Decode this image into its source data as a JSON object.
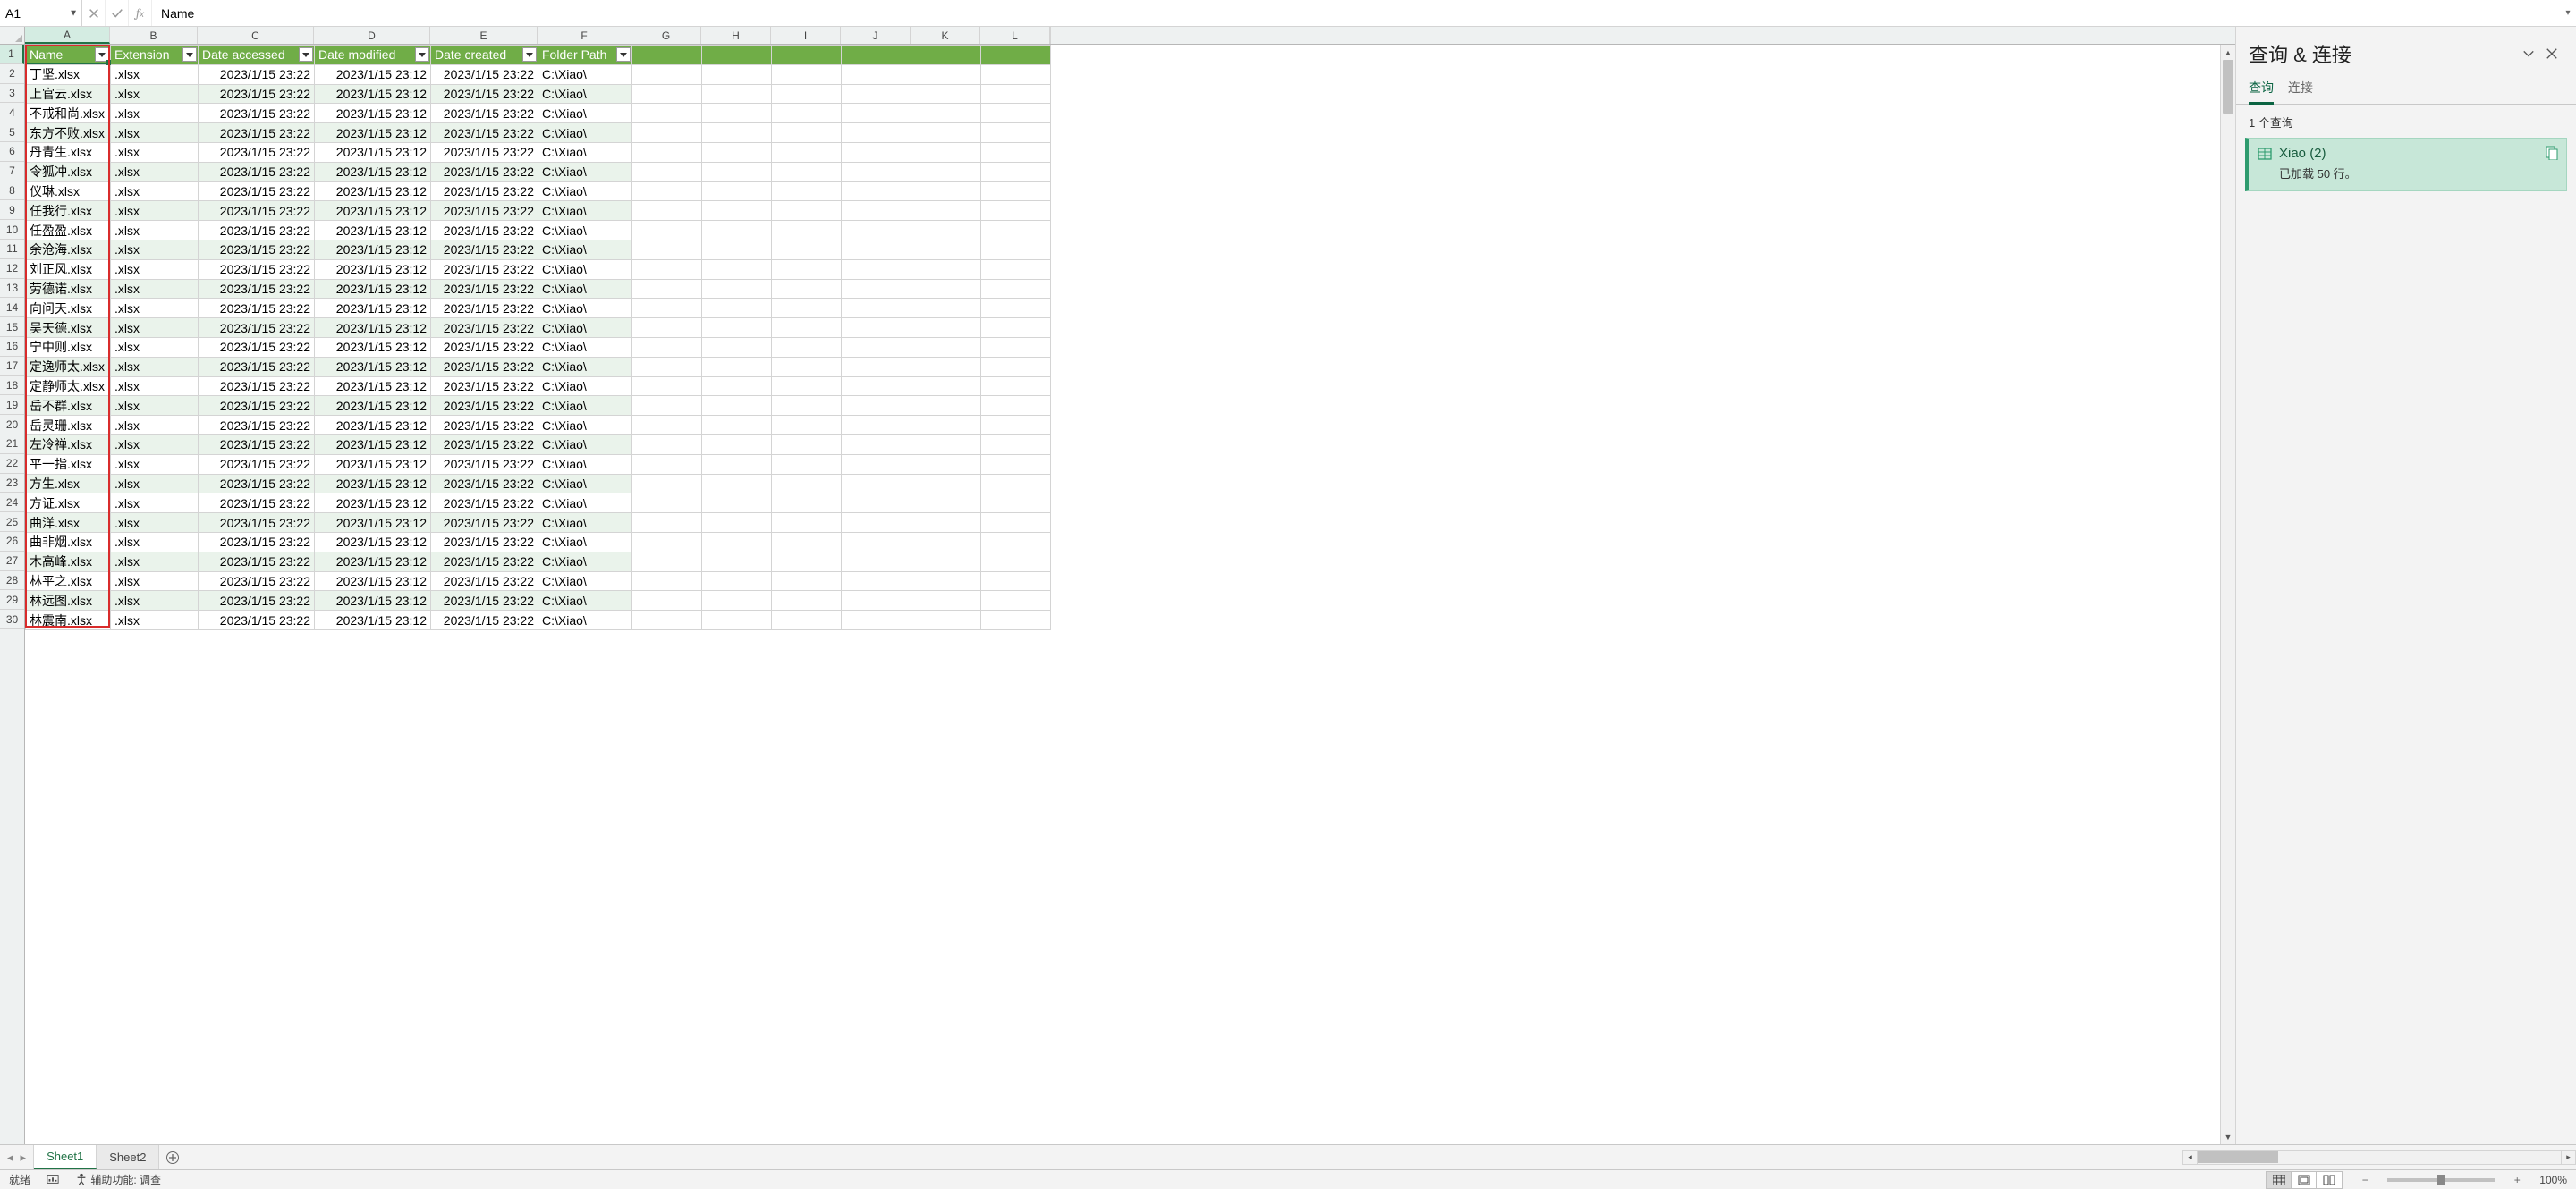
{
  "formula_bar": {
    "name_box": "A1",
    "formula": "Name"
  },
  "columns": [
    "A",
    "B",
    "C",
    "D",
    "E",
    "F",
    "G",
    "H",
    "I",
    "J",
    "K",
    "L"
  ],
  "col_widths_class": [
    "wA",
    "wB",
    "wC",
    "wD",
    "wE",
    "wF",
    "wRest",
    "wRest",
    "wRest",
    "wRest",
    "wRest",
    "wRest"
  ],
  "row_count_visible": 30,
  "table": {
    "headers": [
      "Name",
      "Extension",
      "Date accessed",
      "Date modified",
      "Date created",
      "Folder Path"
    ],
    "rows": [
      {
        "name": "丁坚.xlsx",
        "ext": ".xlsx",
        "accessed": "2023/1/15 23:22",
        "modified": "2023/1/15 23:12",
        "created": "2023/1/15 23:22",
        "folder": "C:\\Xiao\\"
      },
      {
        "name": "上官云.xlsx",
        "ext": ".xlsx",
        "accessed": "2023/1/15 23:22",
        "modified": "2023/1/15 23:12",
        "created": "2023/1/15 23:22",
        "folder": "C:\\Xiao\\"
      },
      {
        "name": "不戒和尚.xlsx",
        "ext": ".xlsx",
        "accessed": "2023/1/15 23:22",
        "modified": "2023/1/15 23:12",
        "created": "2023/1/15 23:22",
        "folder": "C:\\Xiao\\"
      },
      {
        "name": "东方不败.xlsx",
        "ext": ".xlsx",
        "accessed": "2023/1/15 23:22",
        "modified": "2023/1/15 23:12",
        "created": "2023/1/15 23:22",
        "folder": "C:\\Xiao\\"
      },
      {
        "name": "丹青生.xlsx",
        "ext": ".xlsx",
        "accessed": "2023/1/15 23:22",
        "modified": "2023/1/15 23:12",
        "created": "2023/1/15 23:22",
        "folder": "C:\\Xiao\\"
      },
      {
        "name": "令狐冲.xlsx",
        "ext": ".xlsx",
        "accessed": "2023/1/15 23:22",
        "modified": "2023/1/15 23:12",
        "created": "2023/1/15 23:22",
        "folder": "C:\\Xiao\\"
      },
      {
        "name": "仪琳.xlsx",
        "ext": ".xlsx",
        "accessed": "2023/1/15 23:22",
        "modified": "2023/1/15 23:12",
        "created": "2023/1/15 23:22",
        "folder": "C:\\Xiao\\"
      },
      {
        "name": "任我行.xlsx",
        "ext": ".xlsx",
        "accessed": "2023/1/15 23:22",
        "modified": "2023/1/15 23:12",
        "created": "2023/1/15 23:22",
        "folder": "C:\\Xiao\\"
      },
      {
        "name": "任盈盈.xlsx",
        "ext": ".xlsx",
        "accessed": "2023/1/15 23:22",
        "modified": "2023/1/15 23:12",
        "created": "2023/1/15 23:22",
        "folder": "C:\\Xiao\\"
      },
      {
        "name": "余沧海.xlsx",
        "ext": ".xlsx",
        "accessed": "2023/1/15 23:22",
        "modified": "2023/1/15 23:12",
        "created": "2023/1/15 23:22",
        "folder": "C:\\Xiao\\"
      },
      {
        "name": "刘正风.xlsx",
        "ext": ".xlsx",
        "accessed": "2023/1/15 23:22",
        "modified": "2023/1/15 23:12",
        "created": "2023/1/15 23:22",
        "folder": "C:\\Xiao\\"
      },
      {
        "name": "劳德诺.xlsx",
        "ext": ".xlsx",
        "accessed": "2023/1/15 23:22",
        "modified": "2023/1/15 23:12",
        "created": "2023/1/15 23:22",
        "folder": "C:\\Xiao\\"
      },
      {
        "name": "向问天.xlsx",
        "ext": ".xlsx",
        "accessed": "2023/1/15 23:22",
        "modified": "2023/1/15 23:12",
        "created": "2023/1/15 23:22",
        "folder": "C:\\Xiao\\"
      },
      {
        "name": "吴天德.xlsx",
        "ext": ".xlsx",
        "accessed": "2023/1/15 23:22",
        "modified": "2023/1/15 23:12",
        "created": "2023/1/15 23:22",
        "folder": "C:\\Xiao\\"
      },
      {
        "name": "宁中则.xlsx",
        "ext": ".xlsx",
        "accessed": "2023/1/15 23:22",
        "modified": "2023/1/15 23:12",
        "created": "2023/1/15 23:22",
        "folder": "C:\\Xiao\\"
      },
      {
        "name": "定逸师太.xlsx",
        "ext": ".xlsx",
        "accessed": "2023/1/15 23:22",
        "modified": "2023/1/15 23:12",
        "created": "2023/1/15 23:22",
        "folder": "C:\\Xiao\\"
      },
      {
        "name": "定静师太.xlsx",
        "ext": ".xlsx",
        "accessed": "2023/1/15 23:22",
        "modified": "2023/1/15 23:12",
        "created": "2023/1/15 23:22",
        "folder": "C:\\Xiao\\"
      },
      {
        "name": "岳不群.xlsx",
        "ext": ".xlsx",
        "accessed": "2023/1/15 23:22",
        "modified": "2023/1/15 23:12",
        "created": "2023/1/15 23:22",
        "folder": "C:\\Xiao\\"
      },
      {
        "name": "岳灵珊.xlsx",
        "ext": ".xlsx",
        "accessed": "2023/1/15 23:22",
        "modified": "2023/1/15 23:12",
        "created": "2023/1/15 23:22",
        "folder": "C:\\Xiao\\"
      },
      {
        "name": "左冷禅.xlsx",
        "ext": ".xlsx",
        "accessed": "2023/1/15 23:22",
        "modified": "2023/1/15 23:12",
        "created": "2023/1/15 23:22",
        "folder": "C:\\Xiao\\"
      },
      {
        "name": "平一指.xlsx",
        "ext": ".xlsx",
        "accessed": "2023/1/15 23:22",
        "modified": "2023/1/15 23:12",
        "created": "2023/1/15 23:22",
        "folder": "C:\\Xiao\\"
      },
      {
        "name": "方生.xlsx",
        "ext": ".xlsx",
        "accessed": "2023/1/15 23:22",
        "modified": "2023/1/15 23:12",
        "created": "2023/1/15 23:22",
        "folder": "C:\\Xiao\\"
      },
      {
        "name": "方证.xlsx",
        "ext": ".xlsx",
        "accessed": "2023/1/15 23:22",
        "modified": "2023/1/15 23:12",
        "created": "2023/1/15 23:22",
        "folder": "C:\\Xiao\\"
      },
      {
        "name": "曲洋.xlsx",
        "ext": ".xlsx",
        "accessed": "2023/1/15 23:22",
        "modified": "2023/1/15 23:12",
        "created": "2023/1/15 23:22",
        "folder": "C:\\Xiao\\"
      },
      {
        "name": "曲非烟.xlsx",
        "ext": ".xlsx",
        "accessed": "2023/1/15 23:22",
        "modified": "2023/1/15 23:12",
        "created": "2023/1/15 23:22",
        "folder": "C:\\Xiao\\"
      },
      {
        "name": "木高峰.xlsx",
        "ext": ".xlsx",
        "accessed": "2023/1/15 23:22",
        "modified": "2023/1/15 23:12",
        "created": "2023/1/15 23:22",
        "folder": "C:\\Xiao\\"
      },
      {
        "name": "林平之.xlsx",
        "ext": ".xlsx",
        "accessed": "2023/1/15 23:22",
        "modified": "2023/1/15 23:12",
        "created": "2023/1/15 23:22",
        "folder": "C:\\Xiao\\"
      },
      {
        "name": "林远图.xlsx",
        "ext": ".xlsx",
        "accessed": "2023/1/15 23:22",
        "modified": "2023/1/15 23:12",
        "created": "2023/1/15 23:22",
        "folder": "C:\\Xiao\\"
      },
      {
        "name": "林震南.xlsx",
        "ext": ".xlsx",
        "accessed": "2023/1/15 23:22",
        "modified": "2023/1/15 23:12",
        "created": "2023/1/15 23:22",
        "folder": "C:\\Xiao\\"
      }
    ]
  },
  "side_pane": {
    "title": "查询 & 连接",
    "tabs": {
      "query": "查询",
      "connection": "连接"
    },
    "count_text": "1 个查询",
    "query": {
      "name": "Xiao (2)",
      "status": "已加载 50 行。"
    }
  },
  "sheet_tabs": {
    "sheet1": "Sheet1",
    "sheet2": "Sheet2"
  },
  "status_bar": {
    "ready": "就绪",
    "accessibility": "辅助功能: 调查",
    "zoom": "100%"
  }
}
